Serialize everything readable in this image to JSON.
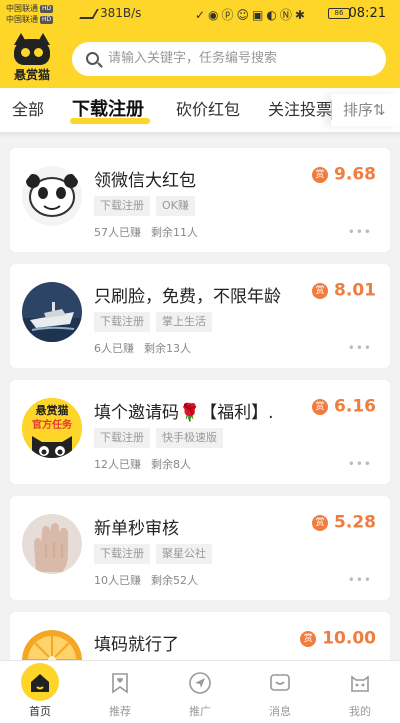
{
  "statusbar": {
    "carrier1": "中国联通",
    "carrier2": "中国联通",
    "hd_badge": "HD",
    "speed": "381B/s",
    "battery": "86",
    "time": "08:21"
  },
  "header": {
    "logo_text": "悬赏猫",
    "search_placeholder": "请输入关键字，任务编号搜索"
  },
  "tabs": [
    {
      "label": "全部"
    },
    {
      "label": "下载注册",
      "active": true
    },
    {
      "label": "砍价红包"
    },
    {
      "label": "关注投票"
    }
  ],
  "sort_label": "排序⇅",
  "reward_icon": "赏",
  "accent_color": "#fed62a",
  "reward_color": "#f07c3d",
  "tasks": [
    {
      "title": "领微信大红包",
      "reward": "9.68",
      "tags": [
        "下载注册",
        "OK赚"
      ],
      "earned": "57人已赚",
      "remaining": "剩余11人",
      "avatar": "panda-meme"
    },
    {
      "title": "只刷脸，免费，不限年龄",
      "reward": "8.01",
      "tags": [
        "下载注册",
        "掌上生活"
      ],
      "earned": "6人已赚",
      "remaining": "剩余13人",
      "avatar": "yacht-photo"
    },
    {
      "title": "填个邀请码🌹【福利】.",
      "reward": "6.16",
      "tags": [
        "下载注册",
        "快手极速版"
      ],
      "earned": "12人已赚",
      "remaining": "剩余8人",
      "avatar": "logo-badge",
      "avatar_text1": "悬赏猫",
      "avatar_text2": "官方任务"
    },
    {
      "title": "新单秒审核",
      "reward": "5.28",
      "tags": [
        "下载注册",
        "聚星公社"
      ],
      "earned": "10人已赚",
      "remaining": "剩余52人",
      "avatar": "hand-photo"
    },
    {
      "title": "填码就行了",
      "reward": "10.00",
      "tags": [],
      "earned": "",
      "remaining": "",
      "avatar": "orange-slice"
    }
  ],
  "tabbar": [
    {
      "label": "首页",
      "icon": "home-icon",
      "active": true
    },
    {
      "label": "推荐",
      "icon": "bookmark-heart-icon"
    },
    {
      "label": "推广",
      "icon": "send-icon"
    },
    {
      "label": "消息",
      "icon": "message-icon"
    },
    {
      "label": "我的",
      "icon": "cat-face-icon"
    }
  ]
}
